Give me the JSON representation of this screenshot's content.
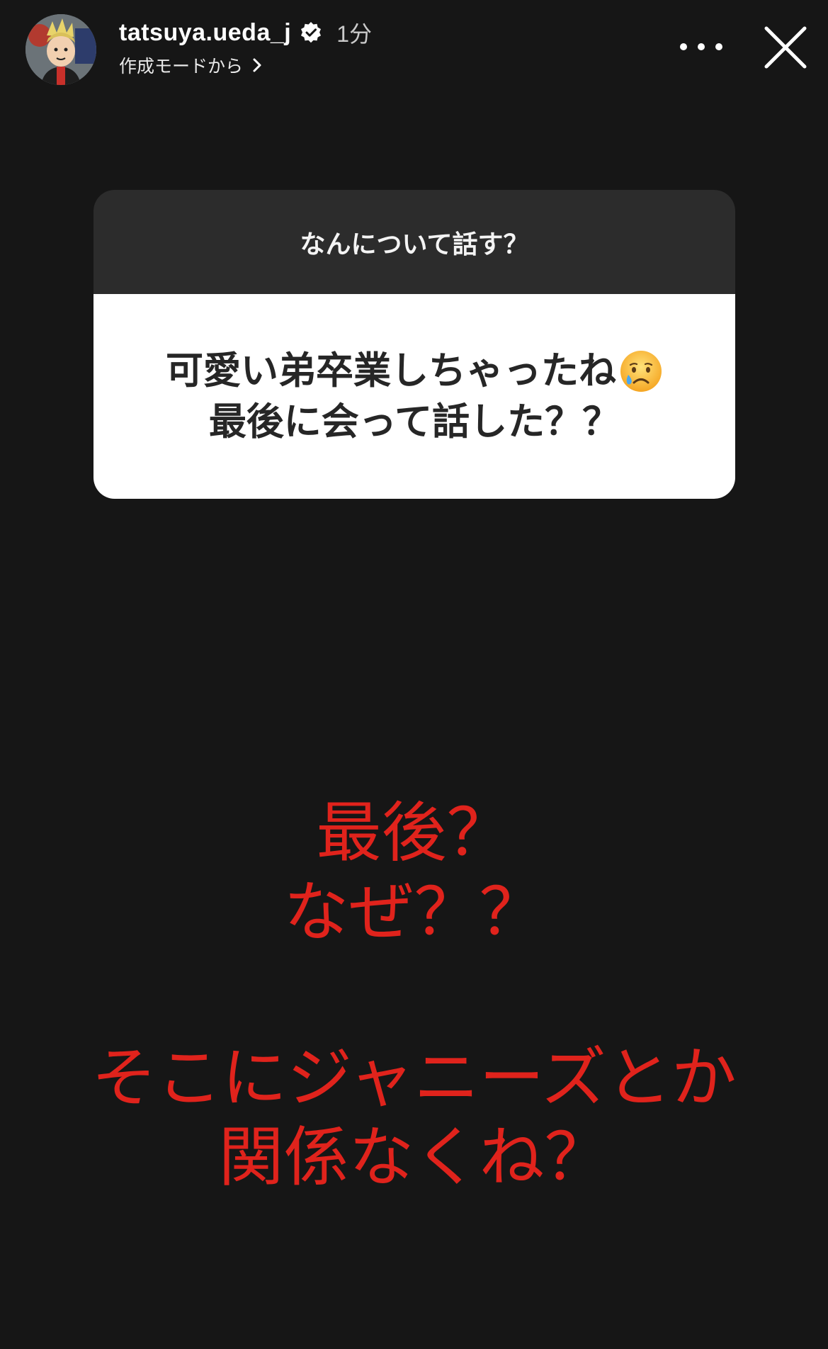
{
  "header": {
    "username": "tatsuya.ueda_j",
    "time": "1分",
    "subtitle": "作成モードから"
  },
  "question_sticker": {
    "prompt": "なんについて話す？",
    "question_line1": "可愛い弟卒業しちゃったね",
    "question_line2": "最後に会って話した？？",
    "emoji": "crying-face-emoji"
  },
  "reply_text": {
    "lines_1": [
      "最後？",
      "なぜ？？"
    ],
    "lines_2": [
      "そこにジャニーズとか",
      "関係なくね？"
    ],
    "color": "#e0231c"
  },
  "colors": {
    "background": "#161616",
    "card_header": "#2c2c2c",
    "card_body": "#ffffff",
    "reply": "#e0231c"
  }
}
